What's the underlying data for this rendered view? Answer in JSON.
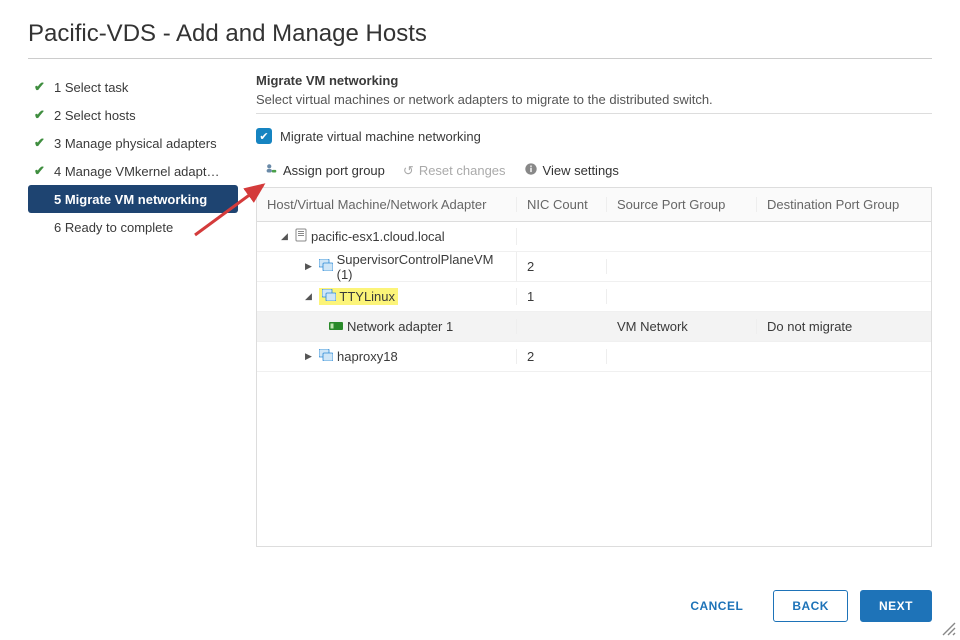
{
  "title": "Pacific-VDS - Add and Manage Hosts",
  "steps": [
    {
      "label": "1 Select task",
      "done": true
    },
    {
      "label": "2 Select hosts",
      "done": true
    },
    {
      "label": "3 Manage physical adapters",
      "done": true
    },
    {
      "label": "4 Manage VMkernel adapt…",
      "done": true
    },
    {
      "label": "5 Migrate VM networking",
      "active": true
    },
    {
      "label": "6 Ready to complete",
      "pending": true
    }
  ],
  "section": {
    "title": "Migrate VM networking",
    "desc": "Select virtual machines or network adapters to migrate to the distributed switch."
  },
  "migrate_checkbox_label": "Migrate virtual machine networking",
  "toolbar": {
    "assign": "Assign port group",
    "reset": "Reset changes",
    "view": "View settings"
  },
  "columns": {
    "c1": "Host/Virtual Machine/Network Adapter",
    "c2": "NIC Count",
    "c3": "Source Port Group",
    "c4": "Destination Port Group"
  },
  "rows": {
    "host": "pacific-esx1.cloud.local",
    "vm1": "SupervisorControlPlaneVM (1)",
    "vm1_nic": "2",
    "vm2": "TTYLinux",
    "vm2_nic": "1",
    "adapter": "Network adapter 1",
    "adapter_src": "VM Network",
    "adapter_dst": "Do not migrate",
    "vm3": "haproxy18",
    "vm3_nic": "2"
  },
  "buttons": {
    "cancel": "CANCEL",
    "back": "BACK",
    "next": "NEXT"
  }
}
